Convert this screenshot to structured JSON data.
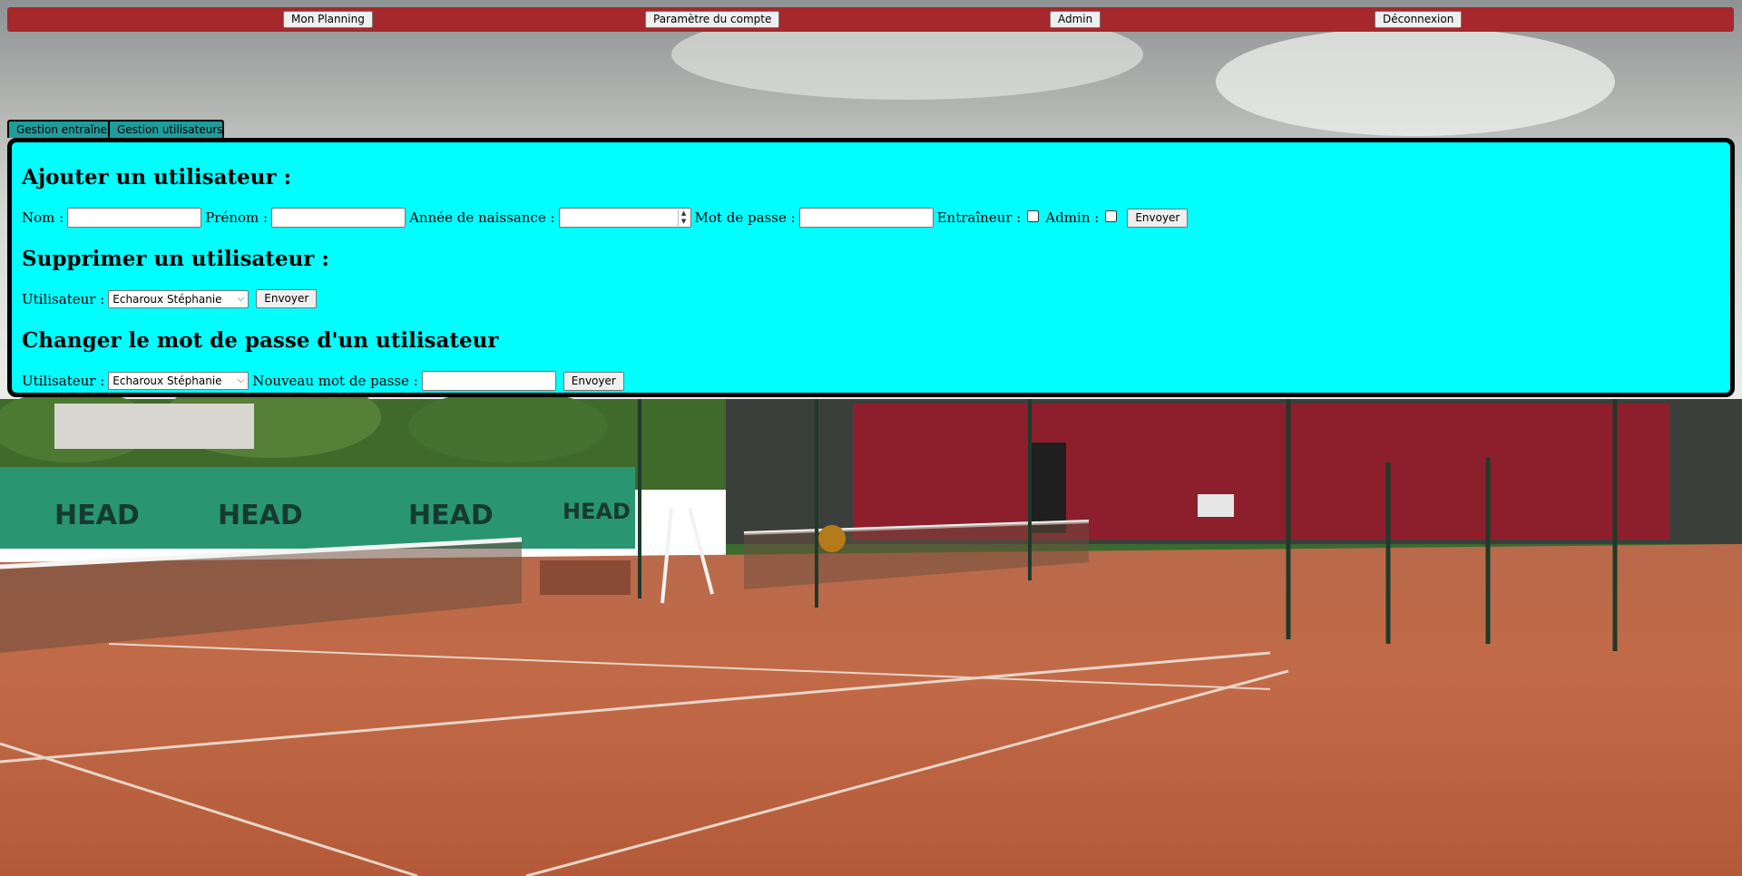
{
  "nav": {
    "items": [
      {
        "label": "Mon Planning"
      },
      {
        "label": "Paramètre du compte"
      },
      {
        "label": "Admin"
      },
      {
        "label": "Déconnexion"
      }
    ]
  },
  "tabs": [
    {
      "label": "Gestion entraîneurs"
    },
    {
      "label": "Gestion utilisateurs"
    }
  ],
  "add_user": {
    "heading": "Ajouter un utilisateur :",
    "nom_label": "Nom :",
    "nom_value": "",
    "prenom_label": "Prénom :",
    "prenom_value": "",
    "annee_label": "Année de naissance :",
    "annee_value": "",
    "mdp_label": "Mot de passe :",
    "mdp_value": "",
    "entraineur_label": "Entraîneur :",
    "admin_label": "Admin :",
    "submit": "Envoyer"
  },
  "delete_user": {
    "heading": "Supprimer un utilisateur :",
    "user_label": "Utilisateur :",
    "user_selected": "Echaroux Stéphanie",
    "submit": "Envoyer"
  },
  "change_password": {
    "heading": "Changer le mot de passe d'un utilisateur",
    "user_label": "Utilisateur :",
    "user_selected": "Echaroux Stéphanie",
    "new_pw_label": "Nouveau mot de passe :",
    "new_pw_value": "",
    "submit": "Envoyer"
  },
  "colors": {
    "topbar": "#a6282c",
    "panel": "#00ffff",
    "tab": "#1f9c9c"
  }
}
